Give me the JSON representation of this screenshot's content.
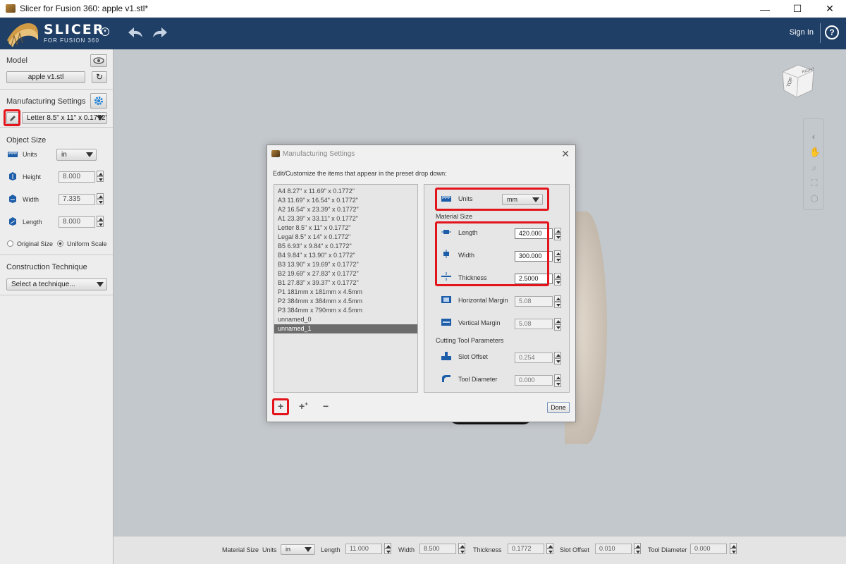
{
  "window": {
    "title": "Slicer for Fusion 360: apple v1.stl*",
    "minimize": "—",
    "maximize": "☐",
    "close": "✕"
  },
  "header": {
    "logo": "SLICER",
    "logo_sub": "FOR FUSION 360",
    "signin": "Sign In",
    "help": "?"
  },
  "left": {
    "model_label": "Model",
    "model_file": "apple v1.stl",
    "manufacturing_label": "Manufacturing Settings",
    "manufacturing_preset": "Letter 8.5\" x 11\" x 0.1772\"",
    "object_size_label": "Object Size",
    "units_label": "Units",
    "units_value": "in",
    "height_label": "Height",
    "height_value": "8.000",
    "width_label": "Width",
    "width_value": "7.335",
    "length_label": "Length",
    "length_value": "8.000",
    "original_size": "Original Size",
    "uniform_scale": "Uniform Scale",
    "construction_label": "Construction Technique",
    "construction_placeholder": "Select a technique..."
  },
  "viewcube": {
    "top": "TOP",
    "right": "RIGHT"
  },
  "dialog": {
    "title": "Manufacturing Settings",
    "instruction": "Edit/Customize the items that appear in the preset drop down:",
    "presets": [
      "A4 8.27\" x 11.69\" x 0.1772\"",
      "A3 11.69\" x 16.54\" x 0.1772\"",
      "A2 16.54\" x 23.39\" x 0.1772\"",
      "A1 23.39\" x 33.11\" x 0.1772\"",
      "Letter 8.5\" x 11\" x 0.1772\"",
      "Legal 8.5\" x 14\" x 0.1772\"",
      "B5 6.93\" x 9.84\" x 0.1772\"",
      "B4 9.84\" x 13.90\" x 0.1772\"",
      "B3 13.90\" x 19.69\" x 0.1772\"",
      "B2 19.69\" x 27.83\" x 0.1772\"",
      "B1 27.83\" x 39.37\" x 0.1772\"",
      "P1 181mm x 181mm x 4.5mm",
      "P2 384mm x 384mm x 4.5mm",
      "P3 384mm x 790mm x 4.5mm",
      "unnamed_0",
      "unnamed_1"
    ],
    "selected_index": 15,
    "units_label": "Units",
    "units_value": "mm",
    "material_size_label": "Material Size",
    "length_label": "Length",
    "length_value": "420.000",
    "width_label": "Width",
    "width_value": "300.000",
    "thickness_label": "Thickness",
    "thickness_value": "2.5000",
    "h_margin_label": "Horizontal Margin",
    "h_margin_value": "5.08",
    "v_margin_label": "Vertical Margin",
    "v_margin_value": "5.08",
    "cutting_label": "Cutting Tool Parameters",
    "slot_offset_label": "Slot Offset",
    "slot_offset_value": "0.254",
    "tool_diameter_label": "Tool Diameter",
    "tool_diameter_value": "0.000",
    "done": "Done"
  },
  "bottom": {
    "material_size": "Material Size",
    "units_label": "Units",
    "units_value": "in",
    "length_label": "Length",
    "length_value": "11.000",
    "width_label": "Width",
    "width_value": "8.500",
    "thickness_label": "Thickness",
    "thickness_value": "0.1772",
    "slot_offset_label": "Slot Offset",
    "slot_offset_value": "0.010",
    "tool_diameter_label": "Tool Diameter",
    "tool_diameter_value": "0.000"
  },
  "colors": {
    "header_bg": "#1f3f66",
    "highlight_red": "#e3141b",
    "panel_bg": "#ededed",
    "viewport_bg": "#c3c8cd"
  }
}
